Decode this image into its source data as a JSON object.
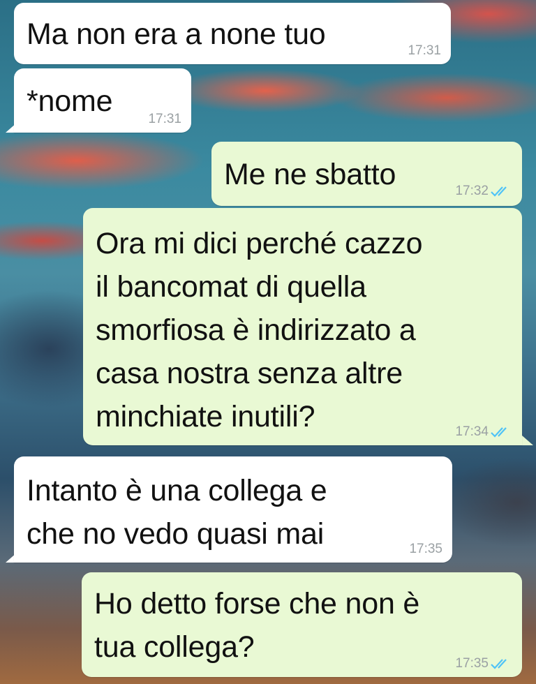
{
  "messages": [
    {
      "direction": "in",
      "text": "Ma non era a none tuo",
      "time": "17:31"
    },
    {
      "direction": "in",
      "text": "*nome",
      "time": "17:31"
    },
    {
      "direction": "out",
      "text": "Me ne sbatto",
      "time": "17:32",
      "status": "read"
    },
    {
      "direction": "out",
      "lines": [
        "Ora mi dici perché cazzo",
        "il bancomat di quella",
        "smorfiosa è indirizzato a",
        "casa nostra senza altre",
        "minchiate inutili?"
      ],
      "time": "17:34",
      "status": "read"
    },
    {
      "direction": "in",
      "lines": [
        "Intanto è una collega e",
        "che no vedo quasi mai"
      ],
      "time": "17:35"
    },
    {
      "direction": "out",
      "lines": [
        "Ho detto forse che non è",
        "tua collega?"
      ],
      "time": "17:35",
      "status": "read"
    }
  ],
  "colors": {
    "incoming": "#ffffff",
    "outgoing": "#e9f9d4",
    "read_ticks": "#4fc3f7",
    "timestamp": "#9aa0a3"
  },
  "icons": {
    "read": "double-check-icon"
  }
}
